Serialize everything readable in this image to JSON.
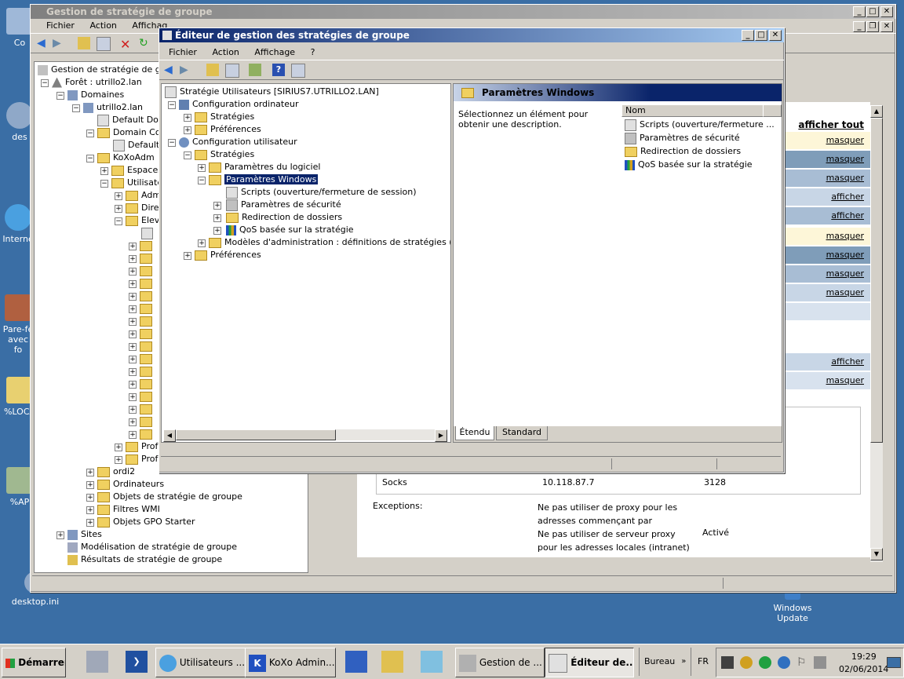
{
  "desktop": {
    "icons": [
      {
        "label": "Co",
        "icon": "recycle-bin-icon"
      },
      {
        "label": "des",
        "icon": "gear-icon"
      },
      {
        "label": "Interne",
        "icon": "ie-icon"
      },
      {
        "label": "Pare-fe avec fo",
        "icon": "firewall-icon"
      },
      {
        "label": "%LOCA",
        "icon": "folder-icon"
      },
      {
        "label": "%AP",
        "icon": "folder-icon"
      },
      {
        "label": "desktop.ini",
        "icon": "gear-icon"
      },
      {
        "label": "Windows Update",
        "icon": "update-icon"
      }
    ]
  },
  "gpmc": {
    "title": "Gestion de stratégie de groupe",
    "menu": [
      "Fichier",
      "Action",
      "Affichag"
    ],
    "tree": [
      {
        "label": "Gestion de stratégie de grou"
      },
      {
        "label": "Forêt : utrillo2.lan"
      },
      {
        "label": "Domaines"
      },
      {
        "label": "utrillo2.lan"
      },
      {
        "label": "Default Dom"
      },
      {
        "label": "Domain Con"
      },
      {
        "label": "Default"
      },
      {
        "label": "KoXoAdm"
      },
      {
        "label": "Espaces"
      },
      {
        "label": "Utilisate"
      },
      {
        "label": "Adm"
      },
      {
        "label": "Dire"
      },
      {
        "label": "Elev"
      },
      {
        "label": "Prof"
      },
      {
        "label": "Prof"
      },
      {
        "label": "ordi2"
      },
      {
        "label": "Ordinateurs"
      },
      {
        "label": "Objets de stratégie de groupe"
      },
      {
        "label": "Filtres WMI"
      },
      {
        "label": "Objets GPO Starter"
      },
      {
        "label": "Sites"
      },
      {
        "label": "Modélisation de stratégie de groupe"
      },
      {
        "label": "Résultats de stratégie de groupe"
      }
    ],
    "right": {
      "show_all": "afficher tout",
      "rows": [
        "masquer",
        "masquer",
        "masquer",
        "afficher",
        "afficher",
        "masquer",
        "masquer",
        "masquer",
        "masquer",
        "afficher",
        "masquer"
      ],
      "socks_label": "Socks",
      "socks_ip": "10.118.87.7",
      "socks_port": "3128",
      "exceptions_label": "Exceptions:",
      "exception_1": "Ne pas utiliser de proxy pour les adresses commençant par",
      "exception_2": "Ne pas utiliser de serveur proxy pour les adresses locales (intranet)",
      "exception_2_value": "Activé"
    }
  },
  "editor": {
    "title": "Éditeur de gestion des stratégies de groupe",
    "menu": [
      "Fichier",
      "Action",
      "Affichage",
      "?"
    ],
    "tree": {
      "root": "Stratégie Utilisateurs [SIRIUS7.UTRILLO2.LAN]",
      "computer_config": "Configuration ordinateur",
      "strategies_1": "Stratégies",
      "preferences_1": "Préférences",
      "user_config": "Configuration utilisateur",
      "strategies_2": "Stratégies",
      "software_settings": "Paramètres du logiciel",
      "windows_settings": "Paramètres Windows",
      "scripts": "Scripts (ouverture/fermeture de session)",
      "security": "Paramètres de sécurité",
      "folder_redirection": "Redirection de dossiers",
      "qos": "QoS basée sur la stratégie",
      "admin_templates": "Modèles d'administration : définitions de stratégies (fichiers",
      "preferences_2": "Préférences"
    },
    "details": {
      "header": "Paramètres Windows",
      "description": "Sélectionnez un élément pour obtenir une description.",
      "column_name": "Nom",
      "items": [
        "Scripts (ouverture/fermeture ...",
        "Paramètres de sécurité",
        "Redirection de dossiers",
        "QoS basée sur la stratégie"
      ]
    },
    "tabs": [
      "Étendu",
      "Standard"
    ]
  },
  "taskbar": {
    "start": "Démarrer",
    "buttons": [
      "Utilisateurs ...",
      "KoXo Admin...",
      "Gestion de ...",
      "Éditeur de..."
    ],
    "bureau": "Bureau",
    "lang": "FR",
    "time": "19:29",
    "date": "02/06/2014"
  },
  "colors": {
    "desktop": "#3a6ea5",
    "title_active": "#0a246a",
    "selection": "#0a246a"
  }
}
